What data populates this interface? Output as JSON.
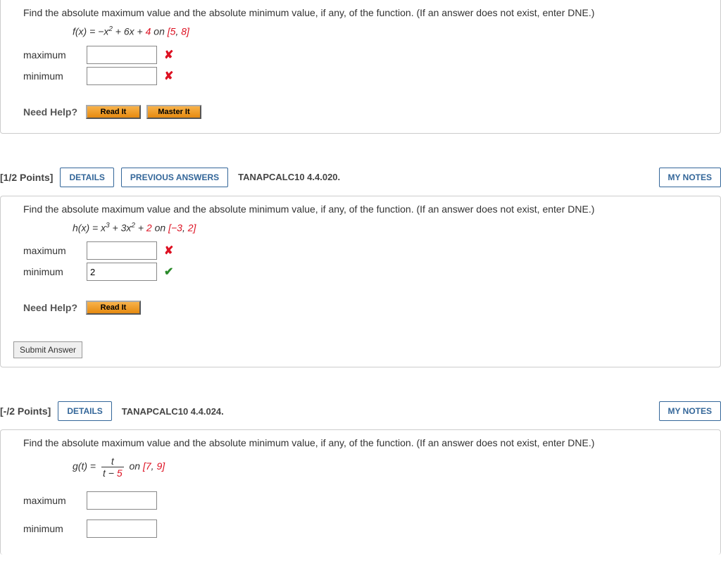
{
  "common": {
    "prompt": "Find the absolute maximum value and the absolute minimum value, if any, of the function. (If an answer does not exist, enter DNE.)",
    "maxLabel": "maximum",
    "minLabel": "minimum",
    "needHelp": "Need Help?",
    "readIt": "Read It",
    "masterIt": "Master It",
    "submit": "Submit Answer",
    "details": "DETAILS",
    "prevAnswers": "PREVIOUS ANSWERS",
    "myNotes": "MY NOTES"
  },
  "q1": {
    "func_prefix": "f(x) = −x",
    "func_exp": "2",
    "func_mid": " + 6x + ",
    "func_const": "4",
    "func_on": " on ",
    "func_interval_a": "[5",
    "func_interval_sep": ", ",
    "func_interval_b": "8]",
    "maxVal": "",
    "minVal": "",
    "maxMark": "✘",
    "minMark": "✘"
  },
  "q2": {
    "points": "[1/2 Points]",
    "ref": "TANAPCALC10 4.4.020.",
    "func_prefix": "h(x) = x",
    "func_exp1": "3",
    "func_mid1": " + 3x",
    "func_exp2": "2",
    "func_mid2": " + ",
    "func_const": "2",
    "func_on": " on ",
    "func_interval_a": "[−3",
    "func_interval_sep": ", ",
    "func_interval_b": "2]",
    "maxVal": "",
    "minVal": "2",
    "maxMark": "✘",
    "minMark": "✔"
  },
  "q3": {
    "points": "[-/2 Points]",
    "ref": "TANAPCALC10 4.4.024.",
    "func_prefix": "g(t) = ",
    "frac_top": "t",
    "frac_bot_a": "t − ",
    "frac_bot_b": "5",
    "func_on": " on ",
    "func_interval_a": "[7",
    "func_interval_sep": ", ",
    "func_interval_b": "9]",
    "maxVal": "",
    "minVal": ""
  }
}
